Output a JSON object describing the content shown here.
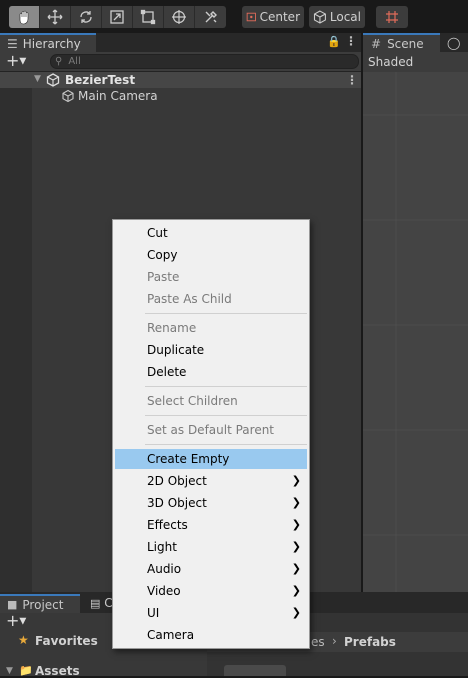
{
  "toolbar": {
    "tools": [
      "hand-tool-icon",
      "move-tool-icon",
      "rotate-tool-icon",
      "scale-tool-icon",
      "rect-tool-icon",
      "transform-tool-icon",
      "custom-tool-icon"
    ],
    "pivot_label": "Center",
    "space_label": "Local"
  },
  "hierarchy": {
    "tab_label": "Hierarchy",
    "search_placeholder": "All",
    "scene_name": "BezierTest",
    "items": [
      {
        "label": "Main Camera"
      }
    ]
  },
  "scene": {
    "tab_label": "Scene",
    "shading": "Shaded"
  },
  "bottom": {
    "project_tab": "Project",
    "console_tab": "C",
    "favorites": "Favorites",
    "assets": "Assets",
    "breadcrumb_prev": "es",
    "breadcrumb_current": "Prefabs"
  },
  "context_menu": {
    "items": [
      {
        "label": "Cut",
        "enabled": true
      },
      {
        "label": "Copy",
        "enabled": true
      },
      {
        "label": "Paste",
        "enabled": false
      },
      {
        "label": "Paste As Child",
        "enabled": false
      },
      {
        "label": "Rename",
        "enabled": false
      },
      {
        "label": "Duplicate",
        "enabled": true
      },
      {
        "label": "Delete",
        "enabled": true
      },
      {
        "label": "Select Children",
        "enabled": false
      },
      {
        "label": "Set as Default Parent",
        "enabled": false
      },
      {
        "label": "Create Empty",
        "enabled": true,
        "highlighted": true
      },
      {
        "label": "2D Object",
        "enabled": true,
        "submenu": true
      },
      {
        "label": "3D Object",
        "enabled": true,
        "submenu": true
      },
      {
        "label": "Effects",
        "enabled": true,
        "submenu": true
      },
      {
        "label": "Light",
        "enabled": true,
        "submenu": true
      },
      {
        "label": "Audio",
        "enabled": true,
        "submenu": true
      },
      {
        "label": "Video",
        "enabled": true,
        "submenu": true
      },
      {
        "label": "UI",
        "enabled": true,
        "submenu": true
      },
      {
        "label": "Camera",
        "enabled": true
      }
    ]
  },
  "colors": {
    "accent": "#3a79bb",
    "highlight": "#99c9ef",
    "favorite_star": "#e8a93a"
  }
}
